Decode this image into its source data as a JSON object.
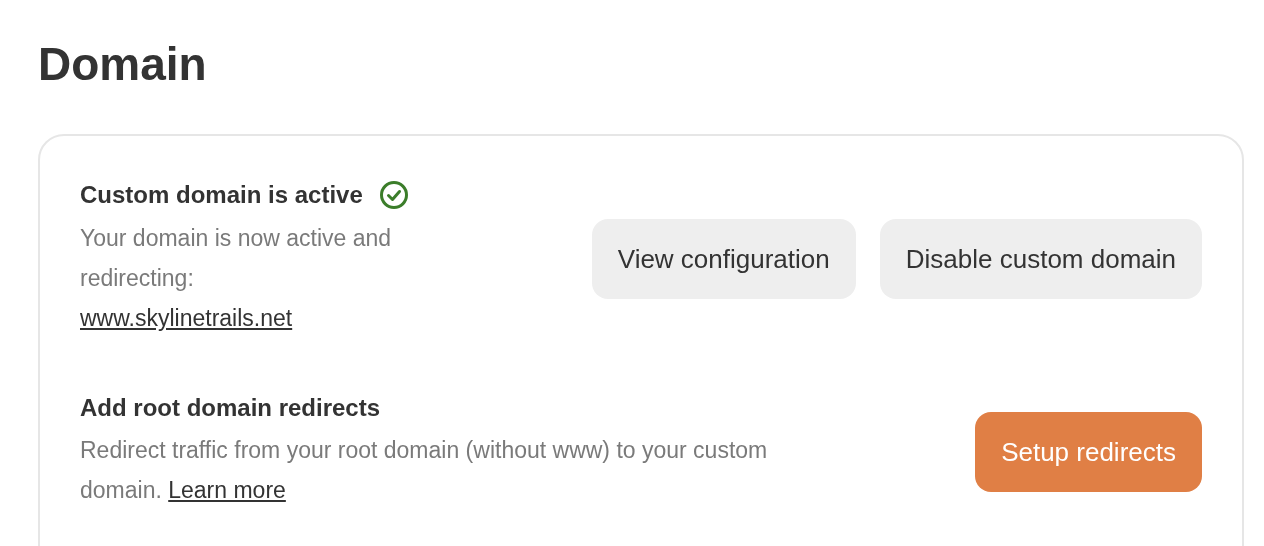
{
  "page_title": "Domain",
  "sections": [
    {
      "kind": "status",
      "title": "Custom domain is active",
      "active": true,
      "description": "Your domain is now active and redirecting:",
      "link": "www.skylinetrails.net",
      "buttons": [
        {
          "label": "View configuration",
          "primary": false
        },
        {
          "label": "Disable custom domain",
          "primary": false
        }
      ]
    },
    {
      "kind": "redirect",
      "title": "Add root domain redirects",
      "active": false,
      "description": "Redirect traffic from your root domain (without www) to your custom domain.",
      "link": "Learn more",
      "buttons": [
        {
          "label": "Setup redirects",
          "primary": true
        }
      ]
    }
  ]
}
